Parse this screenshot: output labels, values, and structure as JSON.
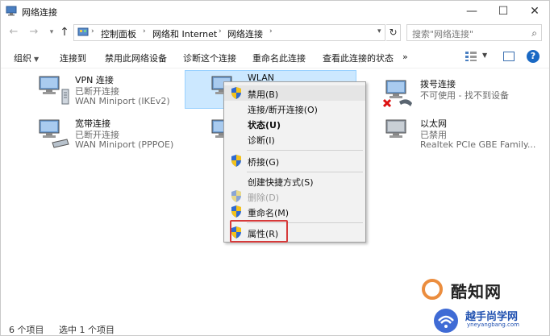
{
  "window": {
    "title": "网络连接"
  },
  "address": {
    "crumbs": [
      "控制面板",
      "网络和 Internet",
      "网络连接"
    ],
    "search_placeholder": "搜索\"网络连接\""
  },
  "toolbar": {
    "items": [
      "组织",
      "连接到",
      "禁用此网络设备",
      "诊断这个连接",
      "重命名此连接",
      "查看此连接的状态",
      "»"
    ]
  },
  "connections": [
    {
      "name": "VPN 连接",
      "status": "已断开连接",
      "device": "WAN Miniport (IKEv2)"
    },
    {
      "name": "宽带连接",
      "status": "已断开连接",
      "device": "WAN Miniport (PPPOE)"
    },
    {
      "name": "WLAN",
      "status": "",
      "device": ""
    },
    {
      "name": "拨号连接",
      "status": "不可使用 - 找不到设备",
      "device": ""
    },
    {
      "name": "以太网",
      "status": "已禁用",
      "device": "Realtek PCIe GBE Family..."
    }
  ],
  "context_menu": {
    "items": [
      {
        "label": "禁用(B)",
        "shield": true,
        "highlighted": true
      },
      {
        "label": "连接/断开连接(O)",
        "shield": false
      },
      {
        "label": "状态(U)",
        "shield": false,
        "bold": true
      },
      {
        "label": "诊断(I)",
        "shield": false
      },
      {
        "label": "桥接(G)",
        "shield": true
      },
      {
        "label": "创建快捷方式(S)",
        "shield": false
      },
      {
        "label": "删除(D)",
        "shield": true,
        "disabled": true
      },
      {
        "label": "重命名(M)",
        "shield": true
      },
      {
        "label": "属性(R)",
        "shield": true
      }
    ]
  },
  "status": {
    "item_count": "6 个项目",
    "selected": "选中 1 个项目"
  },
  "watermark": {
    "brand": "酷知网",
    "site": "yneyangbang.com",
    "brand2": "越手尚学网"
  },
  "colors": {
    "selection": "#cce8ff",
    "highlight_box": "#d63a3a",
    "accent": "#1a69c4"
  }
}
